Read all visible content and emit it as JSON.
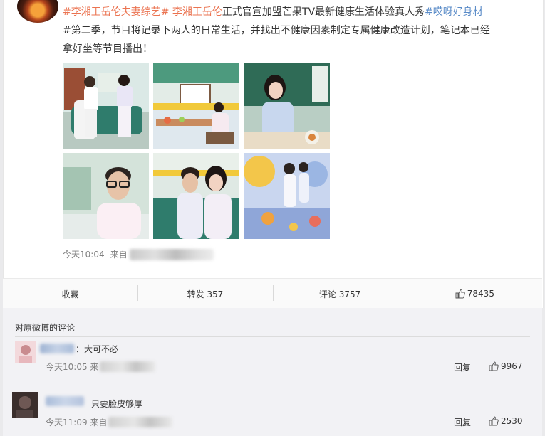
{
  "post": {
    "topic1": "#李湘王岳伦夫妻综艺#",
    "mention": " 李湘王岳伦",
    "line1_rest": "正式官宣加盟芒果TV最新健康生活体验真人秀",
    "topic2": "#哎呀好身材",
    "line2": "#第二季，节目将记录下两人的日常生活，并找出不健康因素制定专属健康改造计划，笔记本已经",
    "line3": "拿好坐等节目播出！",
    "time": "今天10:04",
    "source_prefix": "来自"
  },
  "photos": [
    {
      "name": "photo-couple-sofa"
    },
    {
      "name": "photo-dining-table"
    },
    {
      "name": "photo-woman-blue-shirt"
    },
    {
      "name": "photo-man-glasses-portrait"
    },
    {
      "name": "photo-couple-sitting"
    },
    {
      "name": "photo-illustration-couple"
    }
  ],
  "actions": {
    "favorite": "收藏",
    "repost": "转发 357",
    "comment": "评论 3757",
    "like": "78435"
  },
  "comments_section": {
    "title": "对原微博的评论",
    "items": [
      {
        "text": "：大可不必",
        "time": "今天10:05 来",
        "reply": "回复",
        "likes": "9967"
      },
      {
        "text": "只要脸皮够厚",
        "time": "今天11:09 来自",
        "reply": "回复",
        "likes": "2530"
      }
    ]
  },
  "colors": {
    "topic": "#eb7350",
    "topic_blue": "#5b8cc8",
    "meta_gray": "#808080"
  },
  "icons": {
    "like": "thumbs-up-icon"
  }
}
